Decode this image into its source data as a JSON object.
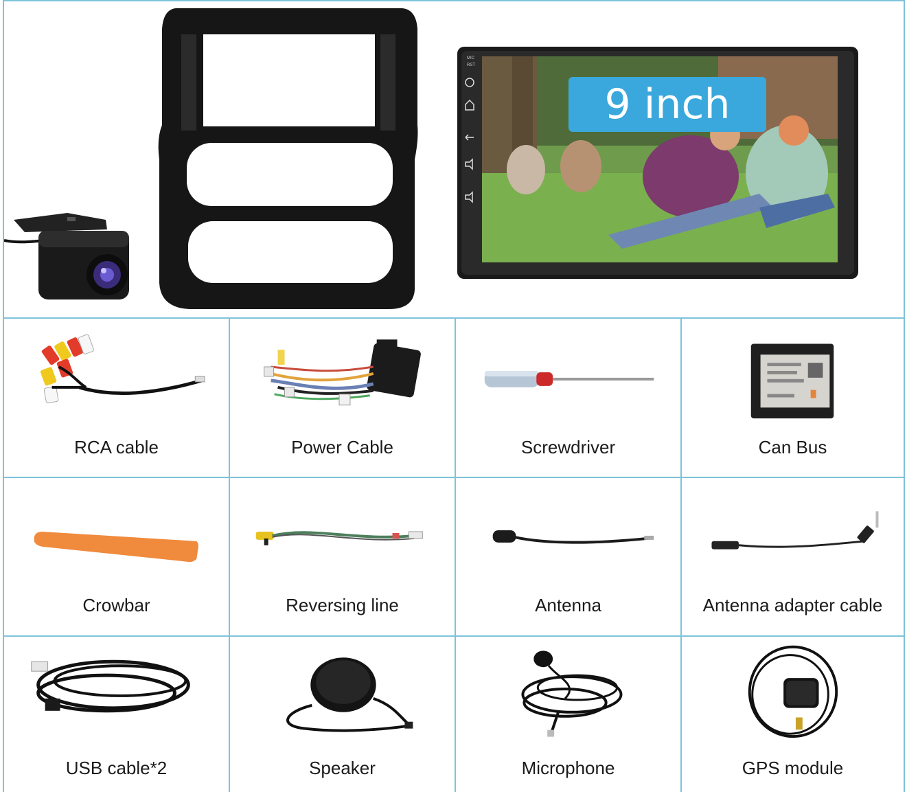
{
  "hero": {
    "screen_badge": "9 inch",
    "screen_side_labels": [
      "MIC",
      "RST"
    ]
  },
  "items": [
    {
      "label": "RCA cable",
      "icon": "rca-cable-icon"
    },
    {
      "label": "Power Cable",
      "icon": "power-cable-icon"
    },
    {
      "label": "Screwdriver",
      "icon": "screwdriver-icon"
    },
    {
      "label": "Can Bus",
      "icon": "can-bus-icon"
    },
    {
      "label": "Crowbar",
      "icon": "crowbar-icon"
    },
    {
      "label": "Reversing line",
      "icon": "reversing-line-icon"
    },
    {
      "label": "Antenna",
      "icon": "antenna-icon"
    },
    {
      "label": "Antenna adapter cable",
      "icon": "antenna-adapter-icon"
    },
    {
      "label": "USB cable*2",
      "icon": "usb-cable-icon"
    },
    {
      "label": "Speaker",
      "icon": "speaker-icon"
    },
    {
      "label": "Microphone",
      "icon": "microphone-icon"
    },
    {
      "label": "GPS module",
      "icon": "gps-module-icon"
    }
  ],
  "colors": {
    "grid_border": "#7ec3da",
    "badge": "#3aa8dc",
    "crowbar": "#f08a3c"
  }
}
